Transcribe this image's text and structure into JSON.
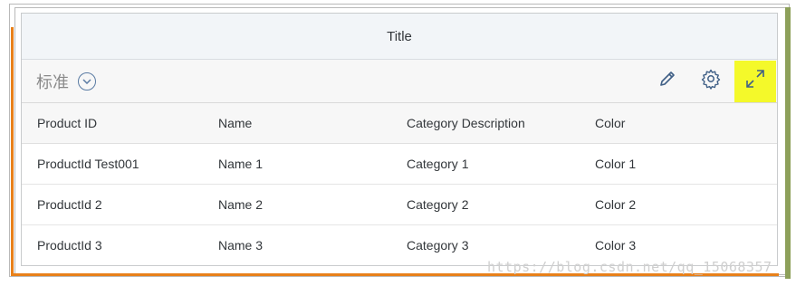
{
  "window": {
    "title": "Title"
  },
  "toolbar": {
    "variant_label": "标准",
    "icons": [
      "edit-icon",
      "settings-icon",
      "fullscreen-icon"
    ]
  },
  "table": {
    "columns": [
      "Product ID",
      "Name",
      "Category Description",
      "Color"
    ],
    "rows": [
      [
        "ProductId Test001",
        "Name 1",
        "Category 1",
        "Color 1"
      ],
      [
        "ProductId 2",
        "Name 2",
        "Category 2",
        "Color 2"
      ],
      [
        "ProductId 3",
        "Name 3",
        "Category 3",
        "Color 3"
      ]
    ]
  },
  "watermark": "https://blog.csdn.net/qq_15068357",
  "colors": {
    "accent": "#5a7ba3",
    "highlight": "#f4f92a",
    "frame_orange": "#e8801a",
    "frame_olive": "#8da05a"
  }
}
